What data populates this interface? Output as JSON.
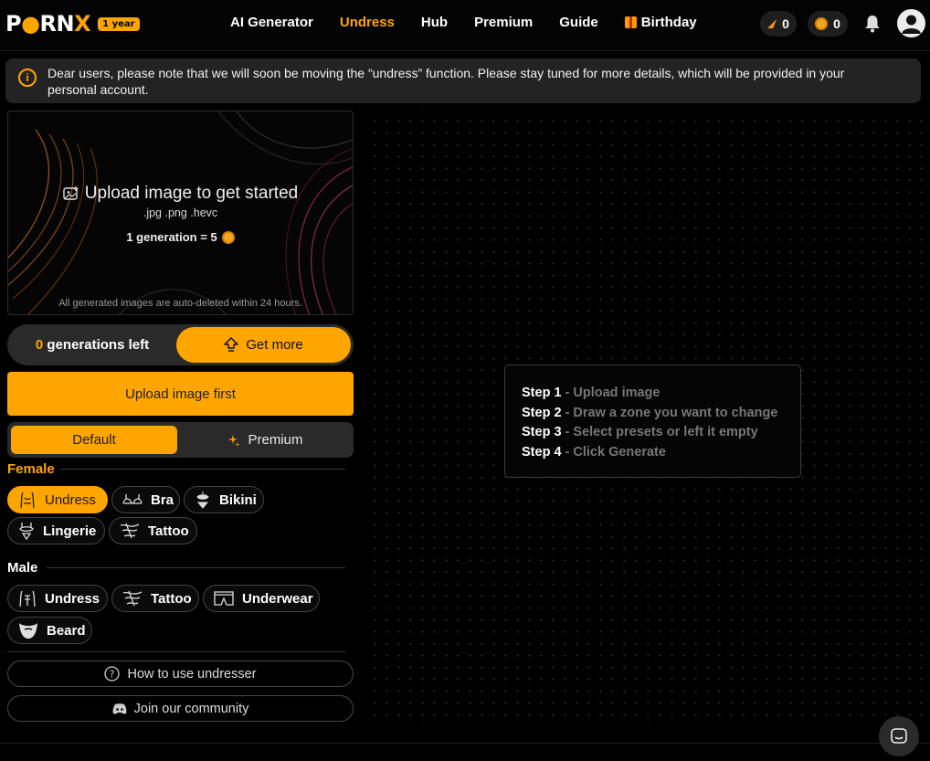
{
  "header": {
    "logo_pre": "P",
    "logo_mid": "RN",
    "logo_x": "X",
    "badge": "1 year",
    "nav": [
      {
        "label": "AI Generator",
        "active": false
      },
      {
        "label": "Undress",
        "active": true
      },
      {
        "label": "Hub",
        "active": false
      },
      {
        "label": "Premium",
        "active": false
      },
      {
        "label": "Guide",
        "active": false
      },
      {
        "label": "Birthday",
        "active": false
      }
    ],
    "sparks_count": "0",
    "coins_count": "0",
    "icons": {
      "bell": "bell-icon",
      "avatar": "user-avatar-icon"
    }
  },
  "notice": {
    "text": "Dear users, please note that we will soon be moving the “undress” function. Please stay tuned for more details, which will be provided in your personal account."
  },
  "upload": {
    "title": "Upload image to get started",
    "formats": ".jpg .png .hevc",
    "cost": "1 generation = 5",
    "note": "All generated images are auto-deleted within 24 hours."
  },
  "generations": {
    "count": "0",
    "label": "generations left",
    "get_more": "Get more"
  },
  "upload_button": "Upload image first",
  "tabs": {
    "default": "Default",
    "premium": "Premium"
  },
  "female": {
    "title": "Female",
    "chips": [
      {
        "label": "Undress",
        "active": true
      },
      {
        "label": "Bra"
      },
      {
        "label": "Bikini"
      },
      {
        "label": "Lingerie"
      },
      {
        "label": "Tattoo"
      }
    ]
  },
  "male": {
    "title": "Male",
    "chips": [
      {
        "label": "Undress"
      },
      {
        "label": "Tattoo"
      },
      {
        "label": "Underwear"
      },
      {
        "label": "Beard"
      }
    ]
  },
  "how_to": "How to use undresser",
  "community": "Join our community",
  "steps": [
    {
      "num": "Step 1",
      "text": " - Upload image"
    },
    {
      "num": "Step 2",
      "text": " - Draw a zone you want to change"
    },
    {
      "num": "Step 3",
      "text": " - Select presets or left it empty"
    },
    {
      "num": "Step 4",
      "text": " - Click Generate"
    }
  ],
  "colors": {
    "accent": "#ffa500",
    "panel": "#2a2a2a",
    "background": "#000000"
  }
}
